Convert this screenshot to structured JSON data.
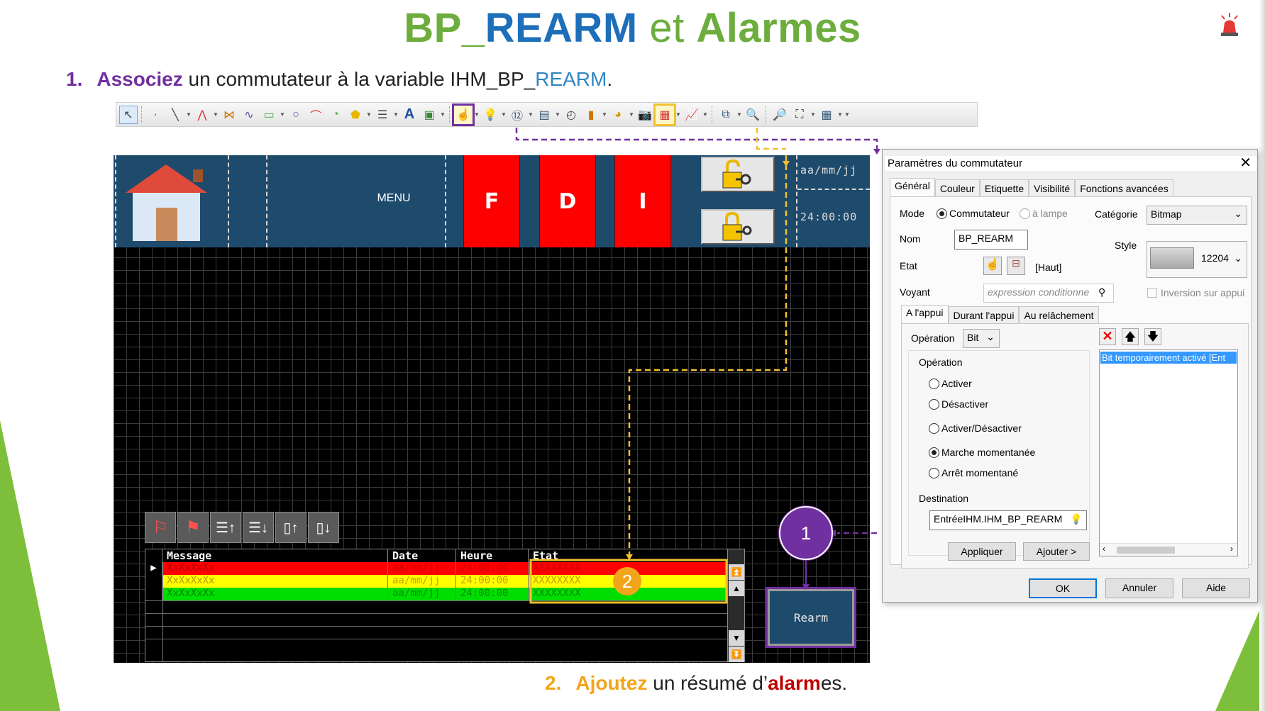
{
  "slide": {
    "title_part1": "BP_",
    "title_part2": "REARM",
    "title_part3": " et ",
    "title_part4": "Alarmes",
    "step1_num": "1.",
    "step1_verb": "Associez",
    "step1_text": " un commutateur à la variable IHM_BP_",
    "step1_var": "REARM",
    "step1_end": ".",
    "step2_num": "2.",
    "step2_verb": "Ajoutez",
    "step2_text": " un résumé d’",
    "step2_red": "alarm",
    "step2_end": "es."
  },
  "hmi": {
    "menu_label": "MENU",
    "buttons": [
      "F",
      "D",
      "I"
    ],
    "date": "aa/mm/jj",
    "time": "24:00:00",
    "rearm_label": "Rearm",
    "badge1": "1",
    "badge2": "2"
  },
  "alarm_table": {
    "columns": [
      "Message",
      "Date",
      "Heure",
      "Etat"
    ],
    "rows": [
      {
        "message": "XxXxXxXx",
        "date": "aa/mm/jj",
        "time": "24:00:00",
        "etat": "XXXXXXXX",
        "color": "#ff0000"
      },
      {
        "message": "XxXxXxXx",
        "date": "aa/mm/jj",
        "time": "24:00:00",
        "etat": "XXXXXXXX",
        "color": "#ffff00"
      },
      {
        "message": "XxXxXxXx",
        "date": "aa/mm/jj",
        "time": "24:00:00",
        "etat": "XXXXXXXX",
        "color": "#00dd00"
      }
    ]
  },
  "dialog": {
    "title": "Paramètres du commutateur",
    "tabs": [
      "Général",
      "Couleur",
      "Etiquette",
      "Visibilité",
      "Fonctions avancées"
    ],
    "mode_label": "Mode",
    "mode_commutateur": "Commutateur",
    "mode_lampe": "à lampe",
    "categorie_label": "Catégorie",
    "categorie_value": "Bitmap",
    "nom_label": "Nom",
    "nom_value": "BP_REARM",
    "style_label": "Style",
    "style_value": "12204",
    "etat_label": "Etat",
    "etat_value": "[Haut]",
    "voyant_label": "Voyant",
    "voyant_placeholder": "expression conditionne",
    "inversion_label": "Inversion sur appui",
    "subtabs": [
      "A l'appui",
      "Durant l'appui",
      "Au relâchement"
    ],
    "operation_label": "Opération",
    "operation_value": "Bit",
    "operation_group": "Opération",
    "op_activer": "Activer",
    "op_desactiver": "Désactiver",
    "op_activer_desactiver": "Activer/Désactiver",
    "op_marche": "Marche momentanée",
    "op_arret": "Arrêt momentané",
    "destination_label": "Destination",
    "destination_value": "EntréeIHM.IHM_BP_REARM",
    "list_item": "Bit temporairement activé [Ent",
    "btn_appliquer": "Appliquer",
    "btn_ajouter": "Ajouter >",
    "btn_ok": "OK",
    "btn_annuler": "Annuler",
    "btn_aide": "Aide"
  },
  "colors": {
    "green": "#6dad3d",
    "blue": "#1e6fba",
    "purple": "#7030a0",
    "orange": "#f2a51a",
    "hmi_panel": "#1e4a6c"
  }
}
